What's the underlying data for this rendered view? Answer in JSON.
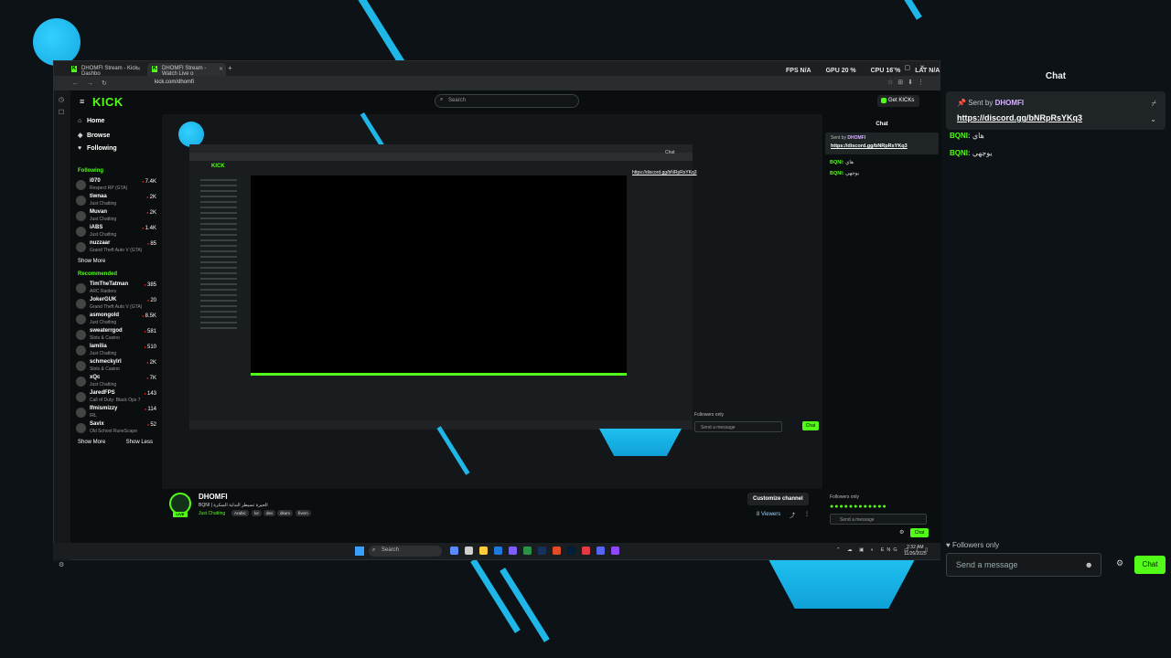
{
  "browser": {
    "tabs": [
      {
        "label": "DHOMFI Stream - Kick Dashbo"
      },
      {
        "label": "DHOMFI Stream - Watch Live o"
      }
    ],
    "new_tab": "+",
    "url": "kick.com/dhomfi"
  },
  "overlay_stats": {
    "fps": "FPS  N/A",
    "gpu": "GPU  20 %",
    "cpu": "CPU  16 %",
    "lat": "LAT  N/A"
  },
  "kick": {
    "logo": "KICK",
    "search_placeholder": "Search",
    "get_kicks": "Get KICKs",
    "nav": [
      {
        "label": "Home",
        "icon": "home-icon"
      },
      {
        "label": "Browse",
        "icon": "browse-icon"
      },
      {
        "label": "Following",
        "icon": "heart-icon"
      }
    ],
    "following_title": "Following",
    "following": [
      {
        "name": "i070",
        "category": "Respect RP (GTA)",
        "viewers": "7.4K"
      },
      {
        "name": "tiwnaa",
        "category": "Just Chatting",
        "viewers": "2K"
      },
      {
        "name": "Muvan",
        "category": "Just Chatting",
        "viewers": "2K"
      },
      {
        "name": "iABS",
        "category": "Just Chatting",
        "viewers": "1.4K"
      },
      {
        "name": "nuzzaar",
        "category": "Grand Theft Auto V (GTA)",
        "viewers": "85"
      }
    ],
    "show_more": "Show More",
    "recommended_title": "Recommended",
    "recommended": [
      {
        "name": "TimTheTatman",
        "category": "ARC Raiders",
        "viewers": "385"
      },
      {
        "name": "JokerGUK",
        "category": "Grand Theft Auto V (GTA)",
        "viewers": "20"
      },
      {
        "name": "asmongold",
        "category": "Just Chatting",
        "viewers": "8.5K"
      },
      {
        "name": "sweaterrgod",
        "category": "Slots & Casino",
        "viewers": "581"
      },
      {
        "name": "lamilia",
        "category": "Just Chatting",
        "viewers": "510"
      },
      {
        "name": "schmeckylrl",
        "category": "Slots & Casino",
        "viewers": "2K"
      },
      {
        "name": "xQc",
        "category": "Just Chatting",
        "viewers": "7K"
      },
      {
        "name": "JaredFPS",
        "category": "Call of Duty: Black Ops 7",
        "viewers": "143"
      },
      {
        "name": "Ifmismizzy",
        "category": "IRL",
        "viewers": "114"
      },
      {
        "name": "Savix",
        "category": "Old School RuneScape",
        "viewers": "52"
      }
    ],
    "show_less": "Show Less",
    "stream": {
      "name": "DHOMFI",
      "title": "BQNI | الحيرة تسيطر البداية المبكرة",
      "category": "Just Chatting",
      "tags": [
        "Arabic",
        "lor",
        "dev",
        "dkam",
        "fivem"
      ],
      "customize": "Customize channel",
      "viewers": "8 Viewers",
      "live_badge": "LIVE"
    },
    "chat": {
      "title": "Chat",
      "sent_by_prefix": "Sent by",
      "sent_by": "DHOMFI",
      "pinned_link": "https://discord.gg/bNRpRsYKq3",
      "messages": [
        {
          "user": "BQNI:",
          "text": "هاي"
        },
        {
          "user": "BQNI:",
          "text": "يوجهي"
        }
      ],
      "followers_only": "Followers only",
      "placeholder": "Send a message",
      "send": "Chat"
    }
  },
  "right_chat": {
    "title": "Chat",
    "sent_by_prefix": "Sent by",
    "sent_by": "DHOMFI",
    "pinned_link": "https://discord.gg/bNRpRsYKq3",
    "messages": [
      {
        "user": "BQNI:",
        "text": "هاي"
      },
      {
        "user": "BQNI:",
        "text": "يوجهي"
      }
    ],
    "followers_only": "Followers only",
    "placeholder": "Send a message",
    "send": "Chat"
  },
  "taskbar": {
    "search": "Search",
    "tray": "ENG",
    "time": "2:32 AM",
    "date": "11/26/2025"
  }
}
